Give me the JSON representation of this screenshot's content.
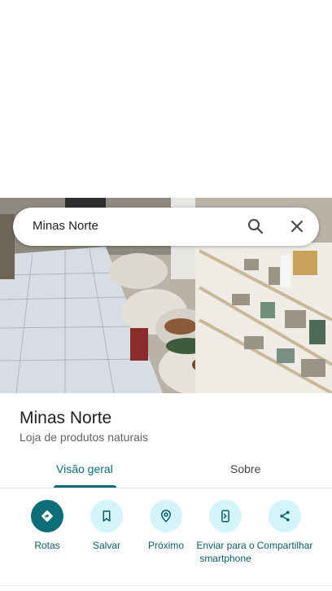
{
  "search": {
    "query": "Minas Norte"
  },
  "place": {
    "name": "Minas Norte",
    "category": "Loja de produtos naturais"
  },
  "tabs": [
    {
      "label": "Visão geral",
      "selected": true
    },
    {
      "label": "Sobre",
      "selected": false
    }
  ],
  "actions": [
    {
      "label": "Rotas",
      "icon": "directions-icon"
    },
    {
      "label": "Salvar",
      "icon": "bookmark-icon"
    },
    {
      "label": "Próximo",
      "icon": "nearby-icon"
    },
    {
      "label": "Enviar para o smartphone",
      "icon": "send-to-phone-icon"
    },
    {
      "label": "Compartilhar",
      "icon": "share-icon"
    }
  ],
  "colors": {
    "accent": "#0b6e78",
    "action_bg": "#d3f4fa",
    "secondary_text": "#5f6368"
  }
}
